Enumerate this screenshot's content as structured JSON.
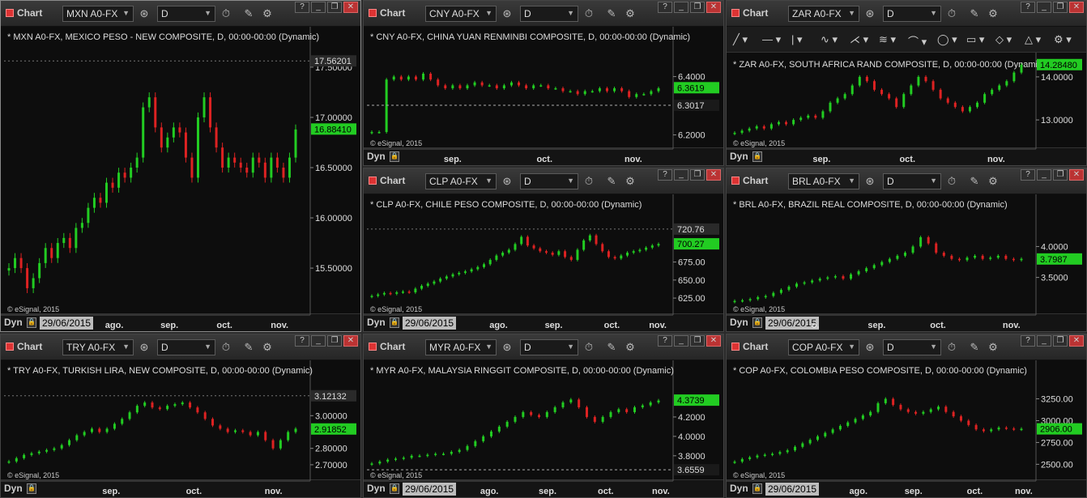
{
  "colors": {
    "up": "#22cc22",
    "down": "#dd2222",
    "bg": "#0d0d0d",
    "grid": "#3a3a3a",
    "text": "#dddddd"
  },
  "app": {
    "window_label": "Chart",
    "interval": "D",
    "dyn_label": "Dyn",
    "copyright": "© eSignal, 2015"
  },
  "drawing_tools": [
    "pencil-line-tool",
    "horizontal-line-tool",
    "vertical-line-tool",
    "freehand-tool",
    "fan-tool",
    "fib-tool",
    "arc-tool",
    "ellipse-tool",
    "rectangle-tool",
    "eraser-tool",
    "triangle-tool",
    "settings-tool"
  ],
  "chart_data": [
    {
      "type": "candlestick",
      "symbol": "MXN A0-FX",
      "title": "* MXN A0-FX, MEXICO PESO - NEW COMPOSITE, D, 00:00-00:00 (Dynamic)",
      "ylim": [
        15.13,
        17.58
      ],
      "yticks": [
        "17.50000",
        "17.00000",
        "16.50000",
        "16.00000",
        "15.50000"
      ],
      "ytick_values": [
        17.5,
        17.0,
        16.5,
        16.0,
        15.5
      ],
      "xticks": [
        "ago.",
        "sep.",
        "oct.",
        "nov."
      ],
      "xtick_pos": [
        0.36,
        0.54,
        0.72,
        0.9
      ],
      "date_label": "29/06/2015",
      "last": {
        "label": "16.88410",
        "value": 16.8841
      },
      "hi": {
        "label": "17.56201",
        "value": 17.562
      },
      "path": [
        15.5,
        15.6,
        15.5,
        15.3,
        15.4,
        15.55,
        15.7,
        15.6,
        15.75,
        15.8,
        15.7,
        15.9,
        15.95,
        16.1,
        16.2,
        16.15,
        16.35,
        16.3,
        16.45,
        16.4,
        16.5,
        16.6,
        17.1,
        17.2,
        16.9,
        16.7,
        16.8,
        16.9,
        16.85,
        16.6,
        16.4,
        17.0,
        17.2,
        16.9,
        16.7,
        16.5,
        16.6,
        16.55,
        16.5,
        16.45,
        16.6,
        16.55,
        16.4,
        16.6,
        16.5,
        16.4,
        16.6,
        16.88
      ]
    },
    {
      "type": "candlestick",
      "symbol": "CNY A0-FX",
      "title": "* CNY A0-FX, CHINA YUAN RENMINBI COMPOSITE, D, 00:00-00:00 (Dynamic)",
      "ylim": [
        6.185,
        6.46
      ],
      "yticks": [
        "6.4000",
        "6.2000"
      ],
      "ytick_values": [
        6.4,
        6.2
      ],
      "xticks": [
        "sep.",
        "oct.",
        "nov."
      ],
      "xtick_pos": [
        0.28,
        0.58,
        0.87
      ],
      "date_label": "",
      "last": {
        "label": "6.3619",
        "value": 6.3619
      },
      "hi": {
        "label": "",
        "value": 0
      },
      "ref": {
        "label": "6.3017",
        "value": 6.3017
      },
      "path": [
        6.21,
        6.21,
        6.39,
        6.4,
        6.39,
        6.4,
        6.39,
        6.41,
        6.39,
        6.37,
        6.36,
        6.37,
        6.36,
        6.37,
        6.38,
        6.37,
        6.37,
        6.36,
        6.37,
        6.38,
        6.37,
        6.36,
        6.37,
        6.37,
        6.36,
        6.36,
        6.35,
        6.35,
        6.34,
        6.35,
        6.35,
        6.36,
        6.35,
        6.36,
        6.35,
        6.33,
        6.34,
        6.34,
        6.35,
        6.36
      ]
    },
    {
      "type": "candlestick",
      "symbol": "ZAR A0-FX",
      "title": "* ZAR A0-FX, SOUTH AFRICA RAND COMPOSITE, D, 00:00-00:00 (Dynamic)",
      "ylim": [
        12.55,
        14.45
      ],
      "yticks": [
        "14.0000",
        "13.0000"
      ],
      "ytick_values": [
        14.0,
        13.0
      ],
      "xticks": [
        "sep.",
        "oct.",
        "nov."
      ],
      "xtick_pos": [
        0.3,
        0.58,
        0.87
      ],
      "date_label": "",
      "last": {
        "label": "14.28480",
        "value": 14.2848
      },
      "hi": {
        "label": "",
        "value": 0
      },
      "path": [
        12.7,
        12.75,
        12.8,
        12.85,
        12.8,
        12.9,
        12.95,
        12.9,
        13.0,
        13.05,
        13.1,
        13.05,
        13.2,
        13.4,
        13.5,
        13.6,
        13.8,
        14.0,
        13.9,
        13.7,
        13.6,
        13.5,
        13.3,
        13.6,
        13.8,
        14.0,
        13.9,
        13.7,
        13.5,
        13.4,
        13.3,
        13.2,
        13.3,
        13.4,
        13.6,
        13.7,
        13.8,
        13.9,
        14.1,
        14.28
      ]
    },
    {
      "type": "candlestick",
      "symbol": "CLP A0-FX",
      "title": "* CLP A0-FX, CHILE PESO COMPOSITE, D, 00:00-00:00 (Dynamic)",
      "ylim": [
        615,
        724
      ],
      "yticks": [
        "675.00",
        "650.00",
        "625.00"
      ],
      "ytick_values": [
        675,
        650,
        625
      ],
      "xticks": [
        "ago.",
        "sep.",
        "oct.",
        "nov."
      ],
      "xtick_pos": [
        0.43,
        0.61,
        0.8,
        0.95
      ],
      "date_label": "29/06/2015",
      "last": {
        "label": "700.27",
        "value": 700.27
      },
      "hi": {
        "label": "720.76",
        "value": 720.76
      },
      "path": [
        628,
        630,
        632,
        631,
        633,
        634,
        633,
        638,
        642,
        645,
        648,
        652,
        655,
        658,
        660,
        662,
        665,
        668,
        672,
        678,
        684,
        688,
        692,
        700,
        710,
        698,
        694,
        690,
        688,
        685,
        690,
        682,
        678,
        692,
        705,
        712,
        700,
        690,
        682,
        680,
        684,
        688,
        690,
        692,
        695,
        698,
        700
      ]
    },
    {
      "type": "candlestick",
      "symbol": "BRL A0-FX",
      "title": "* BRL A0-FX, BRAZIL REAL COMPOSITE, D, 00:00-00:00 (Dynamic)",
      "ylim": [
        3.05,
        4.32
      ],
      "yticks": [
        "4.0000",
        "3.5000"
      ],
      "ytick_values": [
        4.0,
        3.5
      ],
      "xticks": [
        "o.",
        "sep.",
        "oct.",
        "nov."
      ],
      "xtick_pos": [
        0.28,
        0.48,
        0.68,
        0.92
      ],
      "date_label": "29/06/2015",
      "last": {
        "label": "3.7987",
        "value": 3.7987
      },
      "hi": {
        "label": "",
        "value": 0
      },
      "path": [
        3.12,
        3.13,
        3.15,
        3.18,
        3.2,
        3.25,
        3.3,
        3.35,
        3.4,
        3.42,
        3.45,
        3.48,
        3.5,
        3.52,
        3.48,
        3.55,
        3.6,
        3.65,
        3.7,
        3.75,
        3.8,
        3.85,
        3.9,
        4.0,
        4.15,
        4.05,
        3.9,
        3.85,
        3.8,
        3.78,
        3.82,
        3.85,
        3.8,
        3.82,
        3.85,
        3.8,
        3.78,
        3.8
      ]
    },
    {
      "type": "candlestick",
      "symbol": "TRY A0-FX",
      "title": "* TRY A0-FX, TURKISH LIRA, NEW COMPOSITE, D, 00:00-00:00 (Dynamic)",
      "ylim": [
        2.66,
        3.14
      ],
      "yticks": [
        "3.00000",
        "2.80000",
        "2.70000"
      ],
      "ytick_values": [
        3.0,
        2.8,
        2.7
      ],
      "xticks": [
        "sep.",
        "oct.",
        "nov."
      ],
      "xtick_pos": [
        0.35,
        0.62,
        0.88
      ],
      "date_label": "",
      "last": {
        "label": "2.91852",
        "value": 2.91852
      },
      "hi": {
        "label": "3.12132",
        "value": 3.12132
      },
      "path": [
        2.72,
        2.74,
        2.76,
        2.77,
        2.78,
        2.79,
        2.8,
        2.82,
        2.85,
        2.88,
        2.9,
        2.92,
        2.9,
        2.92,
        2.95,
        2.98,
        3.02,
        3.06,
        3.08,
        3.05,
        3.04,
        3.06,
        3.07,
        3.08,
        3.05,
        3.02,
        2.98,
        2.94,
        2.92,
        2.9,
        2.91,
        2.9,
        2.88,
        2.9,
        2.85,
        2.8,
        2.85,
        2.9,
        2.92
      ]
    },
    {
      "type": "candlestick",
      "symbol": "MYR A0-FX",
      "title": "* MYR A0-FX, MALAYSIA RINGGIT COMPOSITE, D, 00:00-00:00 (Dynamic)",
      "ylim": [
        3.64,
        4.45
      ],
      "yticks": [
        "4.2000",
        "4.0000",
        "3.8000"
      ],
      "ytick_values": [
        4.2,
        4.0,
        3.8
      ],
      "xticks": [
        "ago.",
        "sep.",
        "oct.",
        "nov."
      ],
      "xtick_pos": [
        0.4,
        0.59,
        0.78,
        0.96
      ],
      "date_label": "29/06/2015",
      "last": {
        "label": "4.3739",
        "value": 4.3739
      },
      "hi": {
        "label": "",
        "value": 0
      },
      "ref": {
        "label": "3.6559",
        "value": 3.6559
      },
      "path": [
        3.72,
        3.74,
        3.76,
        3.77,
        3.78,
        3.8,
        3.8,
        3.81,
        3.82,
        3.82,
        3.84,
        3.86,
        3.9,
        3.95,
        4.0,
        4.05,
        4.1,
        4.15,
        4.2,
        4.25,
        4.22,
        4.2,
        4.25,
        4.3,
        4.35,
        4.38,
        4.3,
        4.2,
        4.15,
        4.2,
        4.25,
        4.28,
        4.25,
        4.3,
        4.32,
        4.35,
        4.37
      ]
    },
    {
      "type": "candlestick",
      "symbol": "COP A0-FX",
      "title": "* COP A0-FX, COLOMBIA PESO COMPOSITE, D, 00:00-00:00 (Dynamic)",
      "ylim": [
        2420,
        3320
      ],
      "yticks": [
        "3250.00",
        "3000.00",
        "2750.00",
        "2500.00"
      ],
      "ytick_values": [
        3250,
        3000,
        2750,
        2500
      ],
      "xticks": [
        "ago.",
        "sep.",
        "oct.",
        "nov."
      ],
      "xtick_pos": [
        0.42,
        0.6,
        0.8,
        0.96
      ],
      "date_label": "29/06/2015",
      "last": {
        "label": "2906.00",
        "value": 2906
      },
      "hi": {
        "label": "",
        "value": 0
      },
      "path": [
        2530,
        2560,
        2580,
        2600,
        2610,
        2620,
        2640,
        2660,
        2700,
        2740,
        2780,
        2820,
        2860,
        2900,
        2940,
        2980,
        3020,
        3060,
        3100,
        3200,
        3250,
        3180,
        3130,
        3100,
        3080,
        3100,
        3130,
        3160,
        3100,
        3050,
        3000,
        2950,
        2900,
        2880,
        2900,
        2920,
        2910,
        2900,
        2906
      ]
    }
  ]
}
